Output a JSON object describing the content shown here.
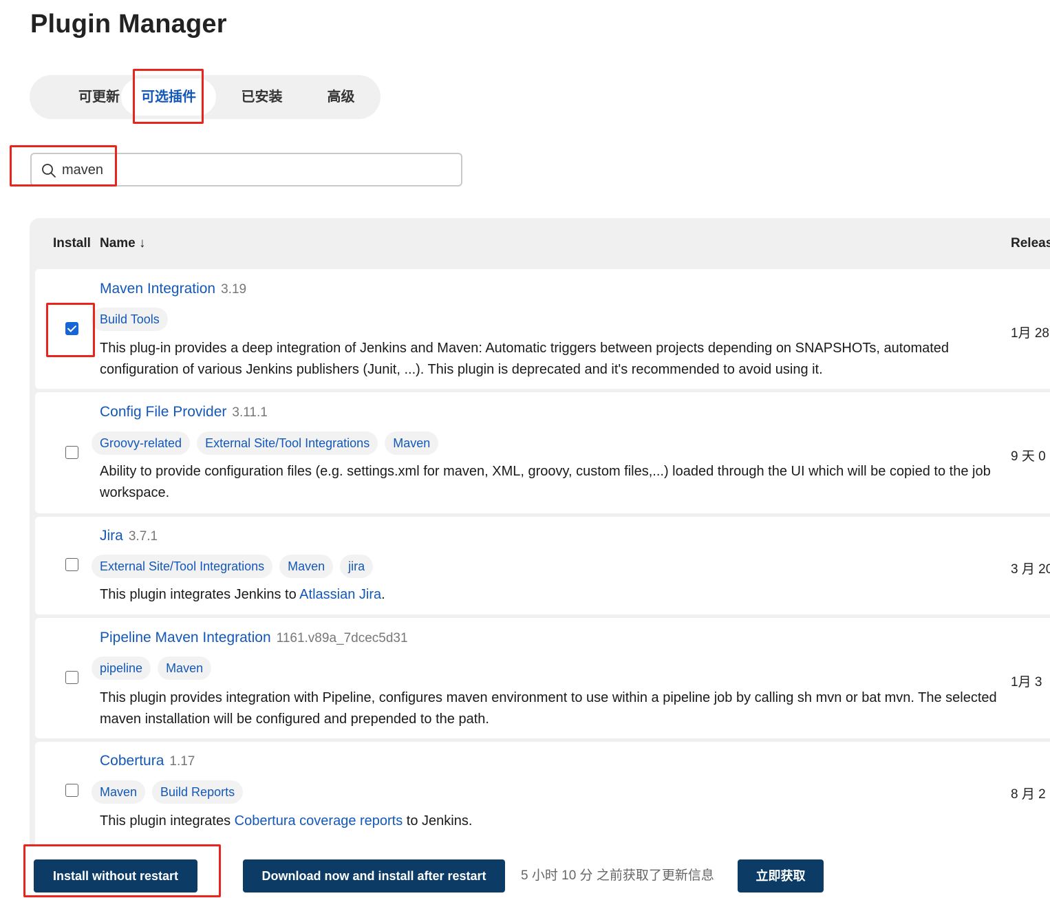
{
  "page": {
    "title": "Plugin Manager"
  },
  "tabs": [
    {
      "label": "可更新"
    },
    {
      "label": "可选插件"
    },
    {
      "label": "已安装"
    },
    {
      "label": "高级"
    }
  ],
  "search": {
    "value": "maven",
    "placeholder": ""
  },
  "table": {
    "headers": {
      "install": "Install",
      "name": "Name ↓",
      "release": "Releas"
    },
    "rows": [
      {
        "name": "Maven Integration",
        "version": "3.19",
        "checked": true,
        "tags": [
          "Build Tools"
        ],
        "description": "This plug-in provides a deep integration of Jenkins and Maven: Automatic triggers between projects depending on SNAPSHOTs, automated configuration of various Jenkins publishers (Junit, ...). This plugin is deprecated and it's recommended to avoid using it.",
        "release": "1月 28"
      },
      {
        "name": "Config File Provider",
        "version": "3.11.1",
        "checked": false,
        "tags": [
          "Groovy-related",
          "External Site/Tool Integrations",
          "Maven"
        ],
        "description": "Ability to provide configuration files (e.g. settings.xml for maven, XML, groovy, custom files,...) loaded through the UI which will be copied to the job workspace.",
        "release": "9 天 0"
      },
      {
        "name": "Jira",
        "version": "3.7.1",
        "checked": false,
        "tags": [
          "External Site/Tool Integrations",
          "Maven",
          "jira"
        ],
        "description_prefix": "This plugin integrates Jenkins to ",
        "description_link": "Atlassian Jira",
        "description_suffix": ".",
        "release": "3 月 20"
      },
      {
        "name": "Pipeline Maven Integration",
        "version": "1161.v89a_7dcec5d31",
        "checked": false,
        "tags": [
          "pipeline",
          "Maven"
        ],
        "description": "This plugin provides integration with Pipeline, configures maven environment to use within a pipeline job by calling sh mvn or bat mvn. The selected maven installation will be configured and prepended to the path.",
        "release": "1月 3"
      },
      {
        "name": "Cobertura",
        "version": "1.17",
        "checked": false,
        "tags": [
          "Maven",
          "Build Reports"
        ],
        "description_prefix": "This plugin integrates ",
        "description_link": "Cobertura coverage reports",
        "description_suffix": " to Jenkins.",
        "release": "8 月 2"
      }
    ]
  },
  "footer": {
    "install_without_restart": "Install without restart",
    "download_and_install_after_restart": "Download now and install after restart",
    "update_info": "5 小时 10 分 之前获取了更新信息",
    "fetch_now": "立即获取"
  },
  "colors": {
    "accent": "#1358b8",
    "button_bg": "#0c3c66",
    "annotation": "#e8241c",
    "checkbox_checked": "#1565d8"
  }
}
